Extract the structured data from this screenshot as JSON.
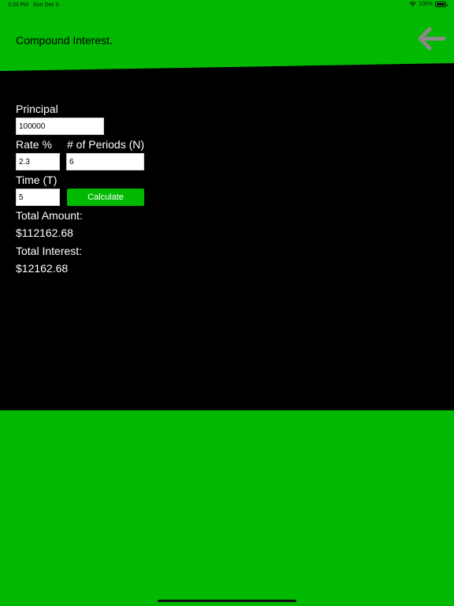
{
  "status_bar": {
    "time": "5:33 PM",
    "date": "Sun Dec 6",
    "battery": "100%"
  },
  "header": {
    "title": "Compound Interest."
  },
  "form": {
    "principal_label": "Principal",
    "principal_value": "100000",
    "rate_label": "Rate %",
    "rate_value": "2.3",
    "periods_label": "# of Periods (N)",
    "periods_value": "6",
    "time_label": "Time (T)",
    "time_value": "5",
    "calculate_label": "Calculate"
  },
  "results": {
    "total_amount_label": "Total Amount:",
    "total_amount_value": "$112162.68",
    "total_interest_label": "Total Interest:",
    "total_interest_value": "$12162.68"
  },
  "colors": {
    "accent_green": "#00b900",
    "panel": "#000000",
    "back_arrow": "#8a8a8a"
  },
  "icons": {
    "back": "arrow-left-icon",
    "wifi": "wifi-icon",
    "battery": "battery-icon"
  }
}
